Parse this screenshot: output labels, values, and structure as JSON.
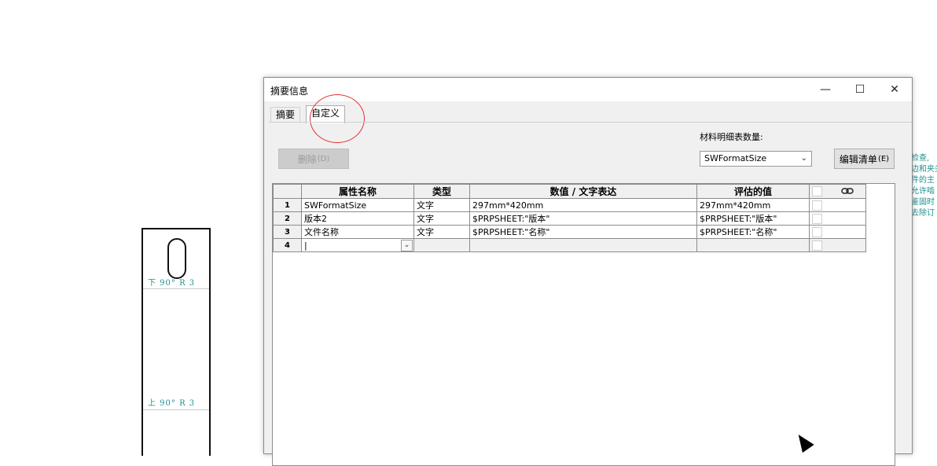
{
  "drawing": {
    "bend_lower": "下 90° R 3",
    "bend_upper": "上 90° R 3",
    "side_note_lines": [
      "检查,",
      "边和夹尖",
      "件的主",
      "允许啮",
      "鉴固时",
      "去除订"
    ]
  },
  "dialog": {
    "title": "摘要信息",
    "controls": {
      "minimize": "—",
      "maximize": "☐",
      "close": "✕"
    },
    "tabs": [
      {
        "label": "摘要",
        "active": false
      },
      {
        "label": "自定义",
        "active": true
      }
    ],
    "delete_button": {
      "label": "删除",
      "accel": "(D)",
      "enabled": false
    },
    "bom_quantity": {
      "label": "材料明细表数量:",
      "selected": "SWFormatSize"
    },
    "edit_list_button": {
      "label": "编辑清单",
      "accel": "(E)"
    },
    "table": {
      "columns": [
        "属性名称",
        "类型",
        "数值 / 文字表达",
        "评估的值"
      ],
      "rows": [
        {
          "num": "1",
          "name": "SWFormatSize",
          "type": "文字",
          "value": "297mm*420mm",
          "evaluated": "297mm*420mm"
        },
        {
          "num": "2",
          "name": "版本2",
          "type": "文字",
          "value": "$PRPSHEET:\"版本\"",
          "evaluated": "$PRPSHEET:\"版本\""
        },
        {
          "num": "3",
          "name": "文件名称",
          "type": "文字",
          "value": "$PRPSHEET:\"名称\"",
          "evaluated": "$PRPSHEET:\"名称\""
        },
        {
          "num": "4",
          "name": "|",
          "type": "",
          "value": "",
          "evaluated": ""
        }
      ]
    }
  },
  "icons": {
    "link": "link-icon",
    "dropdown": "chevron-down-icon",
    "cursor": "mouse-pointer-icon"
  }
}
